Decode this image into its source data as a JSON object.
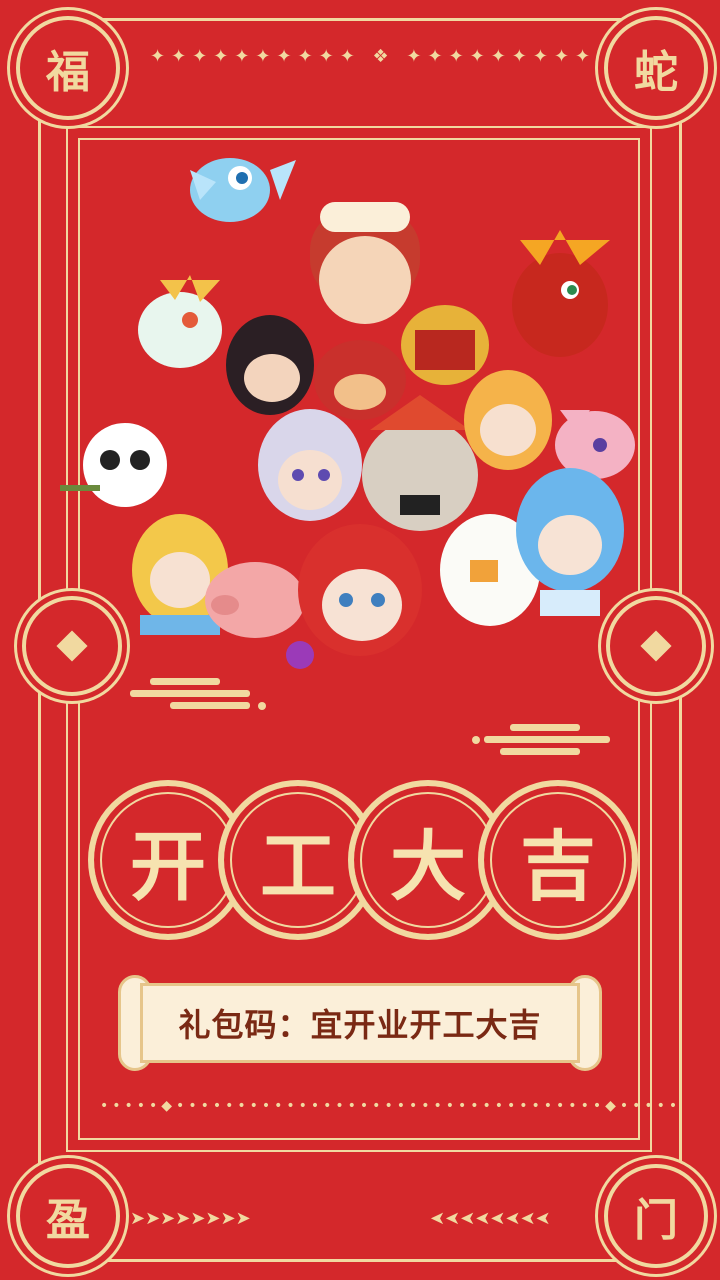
{
  "corners": {
    "top_left": "福",
    "top_right": "蛇",
    "bottom_left": "盈",
    "bottom_right": "门"
  },
  "headline": [
    "开",
    "工",
    "大",
    "吉"
  ],
  "gift_code": "礼包码：宜开业开工大吉",
  "colors": {
    "background": "#d4282b",
    "gold": "#f1d9a0",
    "scroll": "#fbefd9",
    "scroll_text": "#7a2914"
  },
  "illustration": "pixel-art-characters-group"
}
